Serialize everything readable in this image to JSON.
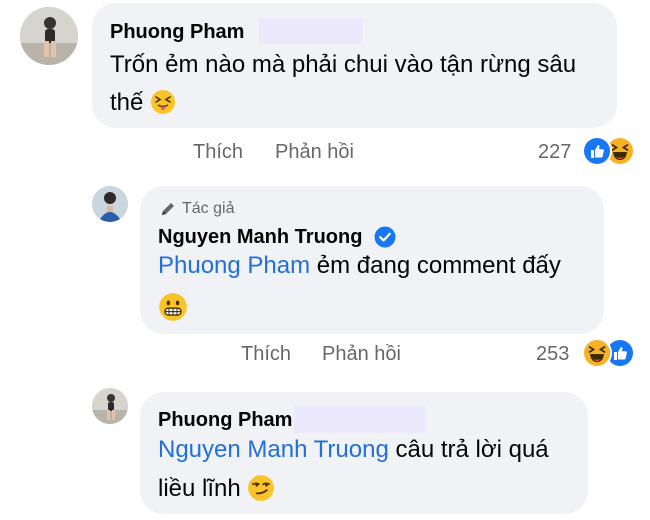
{
  "comments": [
    {
      "author": "Phuong Pham",
      "line1": "Trốn ẻm nào mà phải chui vào tận rừng sâu",
      "line2": "thế",
      "emoji": "squinting-tongue-emoji",
      "actions": {
        "like": "Thích",
        "reply": "Phản hồi"
      },
      "reaction_count": "227",
      "reactions": [
        "like-reaction-icon",
        "haha-reaction-icon"
      ]
    },
    {
      "author_tag": "Tác giả",
      "author": "Nguyen Manh Truong",
      "verified": true,
      "mention": "Phuong Pham",
      "line1_rest": " ẻm đang comment đấy",
      "emoji": "grimacing-emoji",
      "actions": {
        "like": "Thích",
        "reply": "Phản hồi"
      },
      "reaction_count": "253",
      "reactions": [
        "haha-reaction-icon",
        "like-reaction-icon"
      ]
    },
    {
      "author": "Phuong Pham",
      "mention": "Nguyen Manh Truong",
      "line1_rest": " câu trả lời quá",
      "line2": "liều lĩnh",
      "emoji": "smirking-emoji"
    }
  ],
  "colors": {
    "bubble": "#f0f2f5",
    "mention": "#216fdb",
    "secondary_text": "#65676b",
    "like_blue": "#1877f2",
    "haha_yellow": "#f7b125",
    "redaction": "#ebe9fb"
  }
}
